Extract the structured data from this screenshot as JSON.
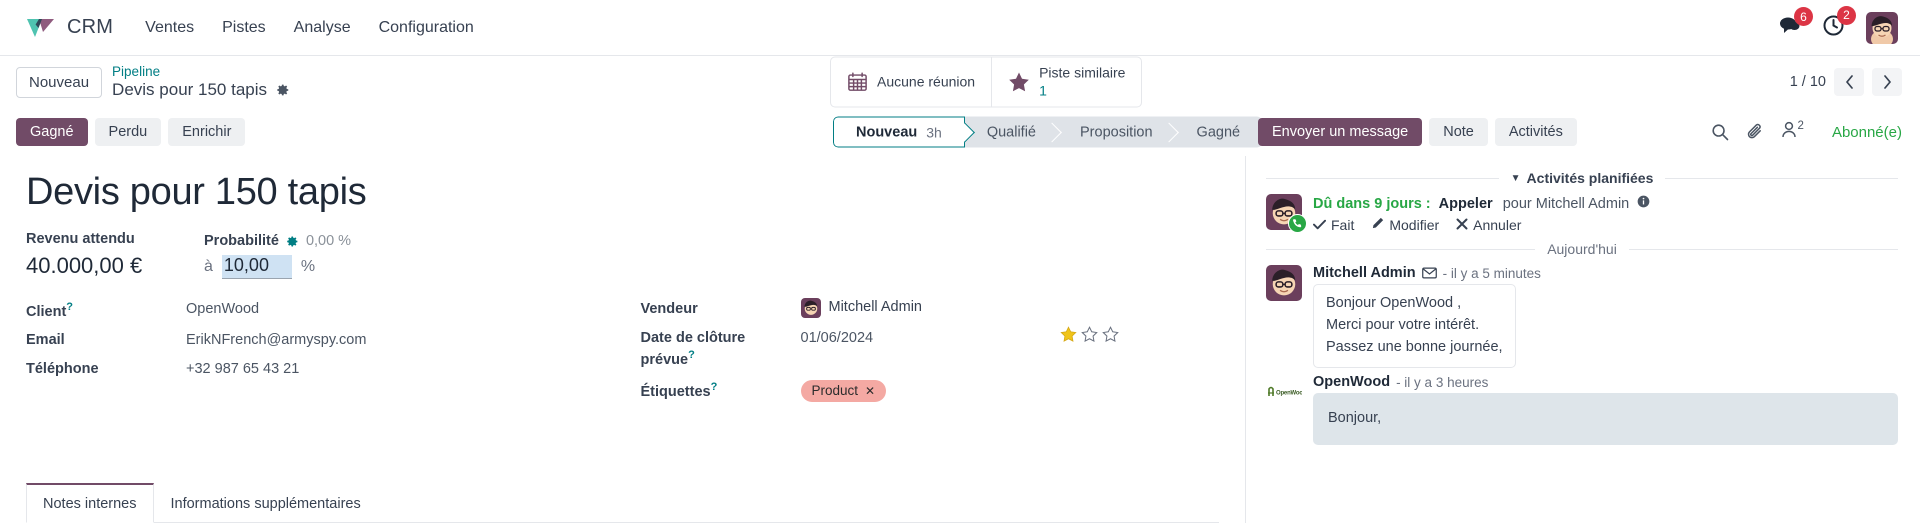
{
  "navbar": {
    "brand": "CRM",
    "menu": [
      "Ventes",
      "Pistes",
      "Analyse",
      "Configuration"
    ],
    "messages_icon": "chat-bubble-icon",
    "messages_badge": "6",
    "activities_icon": "clock-icon",
    "activities_badge": "2",
    "avatar_icon": "user-avatar"
  },
  "controlpanel": {
    "new_button": "Nouveau",
    "breadcrumb_parent": "Pipeline",
    "breadcrumb_current": "Devis pour 150 tapis",
    "settings_icon": "gear-icon",
    "stat_buttons": [
      {
        "icon": "calendar-icon",
        "label": "Aucune réunion",
        "value": ""
      },
      {
        "icon": "star-icon",
        "label": "Piste similaire",
        "value": "1"
      }
    ],
    "pager_value": "1 / 10",
    "pager_prev_icon": "chevron-left-icon",
    "pager_next_icon": "chevron-right-icon"
  },
  "actions": {
    "won": "Gagné",
    "lost": "Perdu",
    "enrich": "Enrichir",
    "stages": [
      {
        "label": "Nouveau",
        "duration": "3h",
        "active": true
      },
      {
        "label": "Qualifié",
        "duration": "",
        "active": false
      },
      {
        "label": "Proposition",
        "duration": "",
        "active": false
      },
      {
        "label": "Gagné",
        "duration": "",
        "active": false
      }
    ],
    "send_message": "Envoyer un message",
    "note": "Note",
    "activities": "Activités",
    "search_icon": "search-icon",
    "attachment_icon": "paperclip-icon",
    "followers_icon": "user-icon",
    "followers_count": "2",
    "following_label": "Abonné(e)"
  },
  "record": {
    "title": "Devis pour 150 tapis",
    "expected_revenue_label": "Revenu attendu",
    "expected_revenue_value": "40.000,00 €",
    "probability_label": "Probabilité",
    "probability_gear_icon": "gear-icon",
    "probability_auto": "0,00 %",
    "probability_prefix": "à",
    "probability_value": "10,00",
    "probability_unit": "%",
    "left_fields": [
      {
        "label": "Client",
        "help": "?",
        "value": "OpenWood"
      },
      {
        "label": "Email",
        "help": "",
        "value": "ErikNFrench@armyspy.com"
      },
      {
        "label": "Téléphone",
        "help": "",
        "value": "+32 987 65 43 21"
      }
    ],
    "right_fields": [
      {
        "label": "Vendeur",
        "help": "",
        "value": "Mitchell Admin",
        "avatar": true
      },
      {
        "label": "Date de clôture prévue",
        "help": "?",
        "value": "01/06/2024",
        "avatar": false
      },
      {
        "label": "Étiquettes",
        "help": "?",
        "value": "",
        "avatar": false
      }
    ],
    "priority_filled": 1,
    "priority_total": 3,
    "tag": "Product",
    "tag_remove_icon": "close-icon",
    "tabs": [
      {
        "label": "Notes internes",
        "active": true
      },
      {
        "label": "Informations supplémentaires",
        "active": false
      }
    ]
  },
  "chatter": {
    "planned_header": "Activités planifiées",
    "planned_caret_icon": "caret-down-icon",
    "activity": {
      "due": "Dû dans 9 jours :",
      "type": "Appeler",
      "assignee": "pour Mitchell Admin",
      "info_icon": "info-icon",
      "avatar_icon": "user-avatar",
      "status_icon": "phone-icon",
      "done": "Fait",
      "done_icon": "check-icon",
      "edit": "Modifier",
      "edit_icon": "pencil-icon",
      "cancel": "Annuler",
      "cancel_icon": "close-icon"
    },
    "day_divider": "Aujourd'hui",
    "messages": [
      {
        "author": "Mitchell Admin",
        "channel_icon": "envelope-icon",
        "time": "- il y a 5 minutes",
        "avatar_icon": "user-avatar",
        "lines": [
          "Bonjour OpenWood ,",
          "Merci pour votre intérêt.",
          "Passez une bonne journée,"
        ],
        "highlighted": false
      },
      {
        "author": "OpenWood",
        "channel_icon": "",
        "time": "- il y a 3 heures",
        "avatar_icon": "openwood-logo",
        "lines": [
          "Bonjour,"
        ],
        "highlighted": true
      }
    ]
  },
  "colors": {
    "brand_primary": "#714b67",
    "accent_teal": "#017e84",
    "badge_red": "#dc3545",
    "success_green": "#28a745",
    "tag_pink": "#f4a9a3",
    "star_gold": "#f0c419"
  }
}
